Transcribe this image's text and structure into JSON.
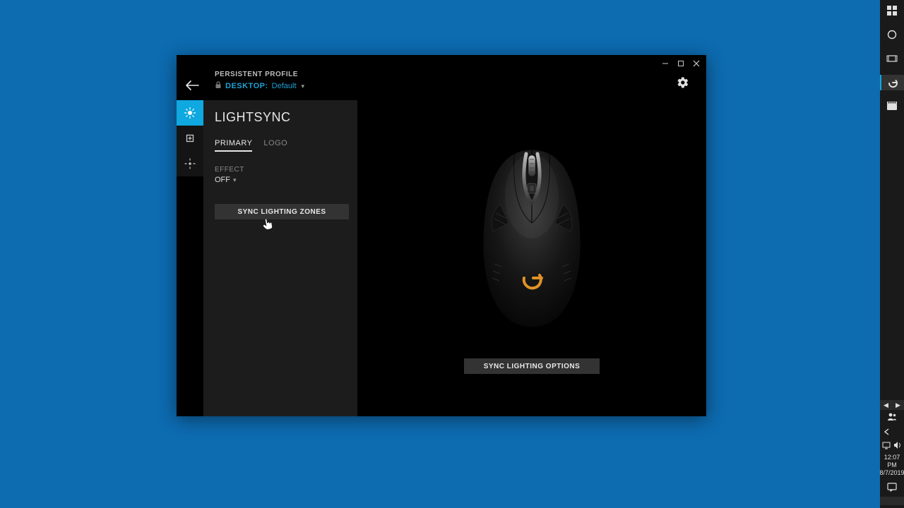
{
  "header": {
    "profile_label": "PERSISTENT PROFILE",
    "desktop_label": "DESKTOP:",
    "default_label": "Default"
  },
  "panel": {
    "title": "LIGHTSYNC",
    "tabs": {
      "primary": "PRIMARY",
      "logo": "LOGO"
    },
    "effect_label": "EFFECT",
    "effect_value": "OFF",
    "sync_zones": "SYNC LIGHTING ZONES"
  },
  "main": {
    "sync_options": "SYNC LIGHTING OPTIONS"
  },
  "taskbar": {
    "time": "12:07 PM",
    "date": "8/7/2019"
  }
}
